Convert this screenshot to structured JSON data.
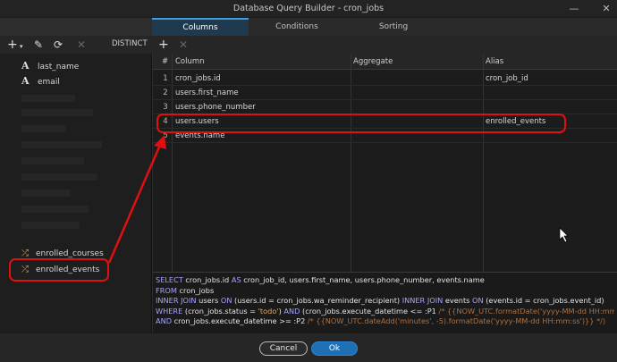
{
  "window": {
    "title": "Database Query Builder - cron_jobs",
    "minimize_icon": "minimize-icon",
    "close_icon": "close-icon"
  },
  "tabs": [
    {
      "label": "Columns",
      "active": true
    },
    {
      "label": "Conditions",
      "active": false
    },
    {
      "label": "Sorting",
      "active": false
    }
  ],
  "left_toolbar": {
    "add": "+",
    "distinct_label": "DISTINCT"
  },
  "right_toolbar": {
    "add": "+",
    "remove": "✕"
  },
  "fields": [
    {
      "label": "last_name",
      "icon": "text-field-icon"
    },
    {
      "label": "email",
      "icon": "text-field-icon"
    }
  ],
  "relations": [
    {
      "label": "enrolled_courses",
      "icon": "shuffle-icon"
    },
    {
      "label": "enrolled_events",
      "icon": "shuffle-icon"
    }
  ],
  "grid": {
    "headers": {
      "num": "#",
      "column": "Column",
      "aggregate": "Aggregate",
      "alias": "Alias"
    },
    "rows": [
      {
        "num": "1",
        "column": "cron_jobs.id",
        "aggregate": "",
        "alias": "cron_job_id"
      },
      {
        "num": "2",
        "column": "users.first_name",
        "aggregate": "",
        "alias": ""
      },
      {
        "num": "3",
        "column": "users.phone_number",
        "aggregate": "",
        "alias": ""
      },
      {
        "num": "4",
        "column": "users.users",
        "aggregate": "",
        "alias": "enrolled_events"
      },
      {
        "num": "5",
        "column": "events.name",
        "aggregate": "",
        "alias": ""
      }
    ]
  },
  "sql": {
    "l1a": "SELECT",
    "l1b": " cron_jobs.id ",
    "l1c": "AS",
    "l1d": " cron_job_id, users.first_name, users.phone_number, events.name",
    "l2a": "FROM",
    "l2b": " cron_jobs",
    "l3a": "INNER JOIN",
    "l3b": " users ",
    "l3c": "ON",
    "l3d": " (users.id = cron_jobs.wa_reminder_recipient) ",
    "l3e": "INNER JOIN",
    "l3f": " events ",
    "l3g": "ON",
    "l3h": " (events.id = cron_jobs.event_id)",
    "l4a": "WHERE",
    "l4b": " (cron_jobs.status = ",
    "l4c": "'todo'",
    "l4d": ") ",
    "l4e": "AND",
    "l4f": " (cron_jobs.execute_datetime <= :P1 ",
    "l4g": "/* {{NOW_UTC.formatDate('yyyy-MM-dd HH:mm:ss')}} */",
    "l5a": "AND",
    "l5b": " cron_jobs.execute_datetime >= :P2 ",
    "l5c": "/* {{NOW_UTC.dateAdd('minutes', -5).formatDate('yyyy-MM-dd HH:mm:ss')}} */)"
  },
  "footer": {
    "cancel": "Cancel",
    "ok": "Ok"
  },
  "annotation_color": "#e01010"
}
